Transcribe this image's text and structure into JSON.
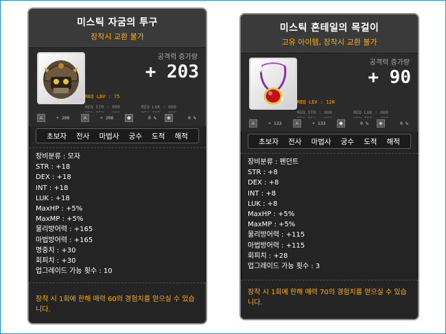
{
  "items": [
    {
      "name": "미스틱 자굼의 투구",
      "tradability": "장착시 교환 불가",
      "stat_label": "공격력 증가량",
      "stat_value": "+ 203",
      "req_lev": "REQ LEV :   75",
      "req": [
        "REQ STR : 000",
        "REQ LUK : 000",
        "REQ DEX : 000",
        "REQ INT : 000"
      ],
      "mods": [
        "+ 206",
        "+ 206",
        "0 %",
        "0 %"
      ],
      "jobs": [
        "초보자",
        "전사",
        "마법사",
        "궁수",
        "도적",
        "해적"
      ],
      "attributes": [
        "장비분류 : 모자",
        "STR : +18",
        "DEX : +18",
        "INT : +18",
        "LUK : +18",
        "MaxHP : +5%",
        "MaxMP : +5%",
        "물리방어력 : +165",
        "마법방어력 : +165",
        "명중치 : +30",
        "회피치 : +30",
        "업그레이드 가능 횟수 : 10"
      ],
      "description": "장착 시 1회에 한해 매력 60의 경험치를 얻으실 수 있습니다."
    },
    {
      "name": "미스틱 혼테일의 목걸이",
      "tradability": "고유 아이템, 장착시 교환 불가",
      "stat_label": "공격력 증가량",
      "stat_value": "+ 90",
      "req_lev": "REQ LEV : 120",
      "req": [
        "REQ STR : 000",
        "REQ LUK : 000",
        "REQ DEX : 000",
        "REQ INT : 000"
      ],
      "mods": [
        "+ 133",
        "+ 133",
        "0 %",
        "0 %"
      ],
      "jobs": [
        "초보자",
        "전사",
        "마법사",
        "궁수",
        "도적",
        "해적"
      ],
      "attributes": [
        "장비분류 : 펜던트",
        "STR : +8",
        "DEX : +8",
        "INT : +8",
        "LUK : +8",
        "MaxHP : +5%",
        "MaxMP : +5%",
        "물리방어력 : +115",
        "마법방어력 : +115",
        "회피치 : +28",
        "업그레이드 가능 횟수 : 3"
      ],
      "description": "장착 시 1회에 한해 매력 70의 경험치를 얻으실 수 있습니다."
    }
  ],
  "colors": {
    "accent": "#ffae00",
    "card_bg": "#242424",
    "text": "#ffffff",
    "frame": "#2f8fd0"
  },
  "icons": [
    "helmet-item-icon",
    "necklace-item-icon"
  ]
}
